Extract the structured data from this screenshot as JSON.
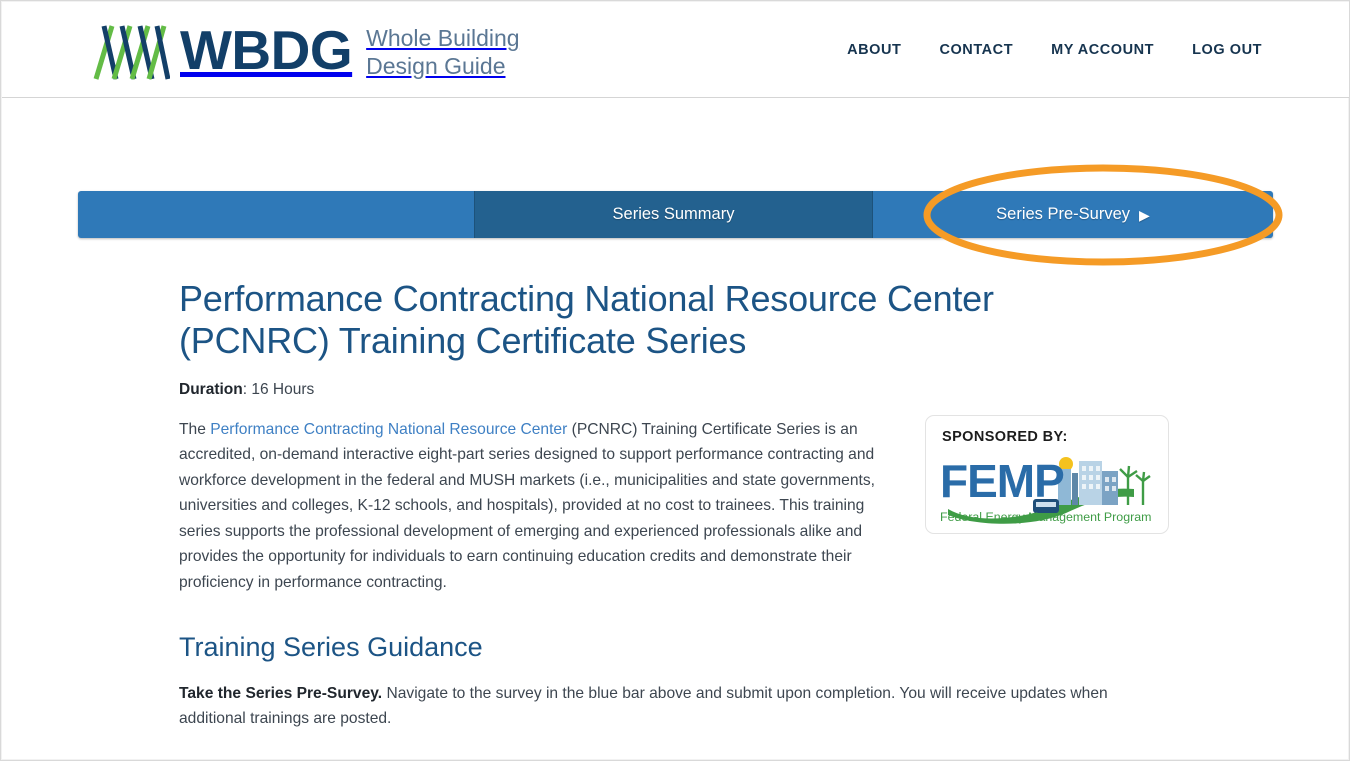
{
  "header": {
    "logo": {
      "wordmark": "WBDG",
      "tagline_line1": "Whole Building",
      "tagline_line2": "Design Guide"
    },
    "nav": [
      {
        "label": "ABOUT"
      },
      {
        "label": "CONTACT"
      },
      {
        "label": "MY ACCOUNT"
      },
      {
        "label": "LOG OUT"
      }
    ]
  },
  "tabbar": {
    "summary_label": "Series Summary",
    "survey_label": "Series Pre-Survey",
    "survey_arrow": "▶",
    "active_tab": "Series Summary",
    "colors": {
      "bar": "#2f79b8",
      "active_tab": "#23618f",
      "highlight": "#f59b26"
    }
  },
  "annotation": {
    "shape": "ellipse",
    "target": "Series Pre-Survey",
    "color": "#f59b26"
  },
  "main": {
    "title": "Performance Contracting National Resource Center (PCNRC) Training Certificate Series",
    "duration_label": "Duration",
    "duration_value": ": 16 Hours",
    "intro": {
      "lead": "The ",
      "link": "Performance Contracting National Resource Center",
      "rest": " (PCNRC) Training Certificate Series is an accredited, on-demand interactive eight-part series designed to support performance contracting and workforce development in the federal and MUSH markets (i.e., municipalities and state governments, universities and colleges, K-12 schools, and hospitals), provided at no cost to trainees. This training series supports the professional development of emerging and experienced professionals alike and provides the opportunity for individuals to earn continuing education credits and demonstrate their proficiency in performance contracting."
    },
    "sponsor": {
      "label": "SPONSORED BY:",
      "logo_text": "FEMP",
      "logo_subtext": "Federal Energy Management Program"
    },
    "section_title": "Training Series Guidance",
    "guidance": {
      "bold": "Take the Series Pre-Survey.",
      "rest": " Navigate to the survey in the blue bar above and submit upon completion. You will receive updates when additional trainings are posted."
    }
  }
}
